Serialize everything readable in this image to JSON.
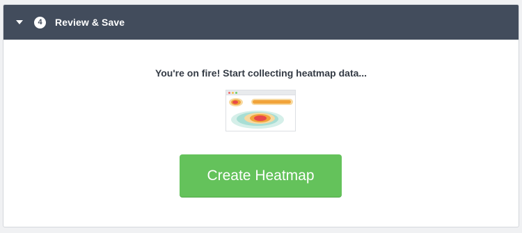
{
  "step": {
    "number": "4",
    "title": "Review & Save"
  },
  "body": {
    "message": "You're on fire! Start collecting heatmap data...",
    "create_button_label": "Create Heatmap"
  },
  "colors": {
    "header_bg": "#424c5c",
    "button_green": "#64c25b",
    "heat_red": "#e8494a",
    "heat_orange": "#f1a33a",
    "heat_teal": "#a8ded4"
  },
  "icons": {
    "caret": "caret-down-icon",
    "preview": "heatmap-preview-icon"
  }
}
